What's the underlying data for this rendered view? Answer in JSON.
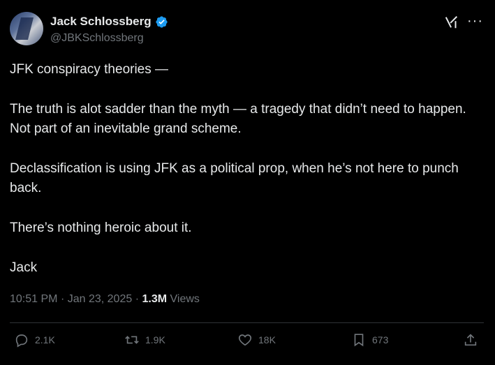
{
  "author": {
    "name": "Jack Schlossberg",
    "handle": "@JBKSchlossberg"
  },
  "header_icons": [
    "grok-icon",
    "more-icon"
  ],
  "more_label": "···",
  "tweet": {
    "paragraphs": [
      "JFK conspiracy theories —",
      "The truth is alot sadder than the myth — a tragedy that didn’t need to happen. Not part of an inevitable grand scheme.",
      "Declassification is using JFK as a political prop, when he’s not here to punch back.",
      "There’s nothing heroic about it.",
      "Jack"
    ]
  },
  "meta": {
    "time": "10:51 PM",
    "separator": "·",
    "date": "Jan 23, 2025",
    "views_count": "1.3M",
    "views_label": "Views"
  },
  "actions": {
    "replies": "2.1K",
    "reposts": "1.9K",
    "likes": "18K",
    "bookmarks": "673"
  },
  "colors": {
    "background": "#000000",
    "text": "#e7e9ea",
    "muted": "#71767b",
    "verified": "#1d9bf0"
  }
}
